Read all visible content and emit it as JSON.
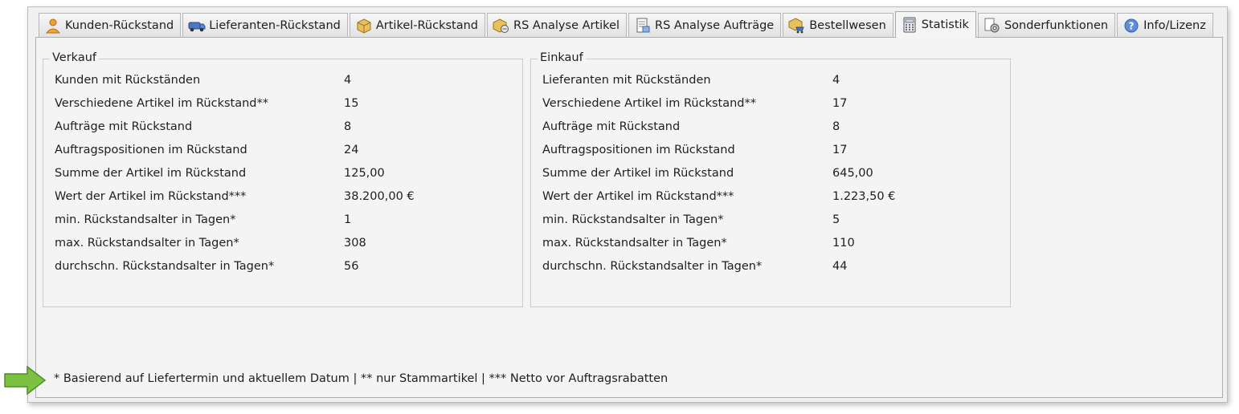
{
  "tabs": [
    {
      "label": "Kunden-Rückstand",
      "icon": "person-icon",
      "active": false
    },
    {
      "label": "Lieferanten-Rückstand",
      "icon": "truck-icon",
      "active": false
    },
    {
      "label": "Artikel-Rückstand",
      "icon": "box-icon",
      "active": false
    },
    {
      "label": "RS Analyse Artikel",
      "icon": "box-analysis-icon",
      "active": false
    },
    {
      "label": "RS Analyse Aufträge",
      "icon": "document-analysis-icon",
      "active": false
    },
    {
      "label": "Bestellwesen",
      "icon": "box-cart-icon",
      "active": false
    },
    {
      "label": "Statistik",
      "icon": "calculator-icon",
      "active": true
    },
    {
      "label": "Sonderfunktionen",
      "icon": "gear-document-icon",
      "active": false
    },
    {
      "label": "Info/Lizenz",
      "icon": "help-icon",
      "active": false
    }
  ],
  "verkauf": {
    "title": "Verkauf",
    "rows": [
      {
        "label": "Kunden mit Rückständen",
        "value": "4"
      },
      {
        "label": "Verschiedene Artikel im Rückstand**",
        "value": "15"
      },
      {
        "label": "Aufträge mit Rückstand",
        "value": "8"
      },
      {
        "label": "Auftragspositionen im Rückstand",
        "value": "24"
      },
      {
        "label": "Summe der Artikel im Rückstand",
        "value": "125,00"
      },
      {
        "label": "Wert der Artikel im Rückstand***",
        "value": "38.200,00 €"
      },
      {
        "label": "min. Rückstandsalter in Tagen*",
        "value": "1"
      },
      {
        "label": "max. Rückstandsalter in Tagen*",
        "value": "308"
      },
      {
        "label": "durchschn. Rückstandsalter in Tagen*",
        "value": "56"
      }
    ]
  },
  "einkauf": {
    "title": "Einkauf",
    "rows": [
      {
        "label": "Lieferanten mit Rückständen",
        "value": "4"
      },
      {
        "label": "Verschiedene Artikel im Rückstand**",
        "value": "17"
      },
      {
        "label": "Aufträge mit Rückstand",
        "value": "8"
      },
      {
        "label": "Auftragspositionen im Rückstand",
        "value": "17"
      },
      {
        "label": "Summe der Artikel im Rückstand",
        "value": "645,00"
      },
      {
        "label": "Wert der Artikel im Rückstand***",
        "value": "1.223,50 €"
      },
      {
        "label": "min. Rückstandsalter in Tagen*",
        "value": "5"
      },
      {
        "label": "max. Rückstandsalter in Tagen*",
        "value": "110"
      },
      {
        "label": "durchschn. Rückstandsalter in Tagen*",
        "value": "44"
      }
    ]
  },
  "footnote": "* Basierend auf Liefertermin und aktuellem Datum | ** nur Stammartikel | *** Netto vor Auftragsrabatten",
  "colors": {
    "arrow": "#7cc142",
    "arrow_border": "#4f8f25"
  }
}
